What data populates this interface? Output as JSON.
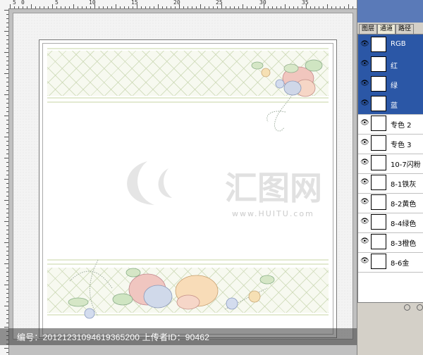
{
  "ruler_top_numbers": [
    "5",
    "0",
    "5",
    "10",
    "15",
    "20",
    "25",
    "30",
    "35"
  ],
  "panel": {
    "tabs": [
      "图层",
      "通道",
      "路径"
    ],
    "channels": [
      {
        "label": "RGB",
        "selected": true
      },
      {
        "label": "红",
        "selected": true
      },
      {
        "label": "绿",
        "selected": true
      },
      {
        "label": "蓝",
        "selected": true
      },
      {
        "label": "专色 2",
        "selected": false
      },
      {
        "label": "专色 3",
        "selected": false
      },
      {
        "label": "10-7闪粉",
        "selected": false
      },
      {
        "label": "8-1铁灰",
        "selected": false
      },
      {
        "label": "8-2黄色",
        "selected": false
      },
      {
        "label": "8-4绿色",
        "selected": false
      },
      {
        "label": "8-3橙色",
        "selected": false
      },
      {
        "label": "8-6金",
        "selected": false
      }
    ]
  },
  "watermark": {
    "brand": "汇图网",
    "url": "www.HUITU.com"
  },
  "caption": "编号：20121231094619365200 上传者ID：90462",
  "colors": {
    "selection": "#2b57a6",
    "panel_bg": "#d4d0c8",
    "lattice": "#c8d6b0"
  }
}
